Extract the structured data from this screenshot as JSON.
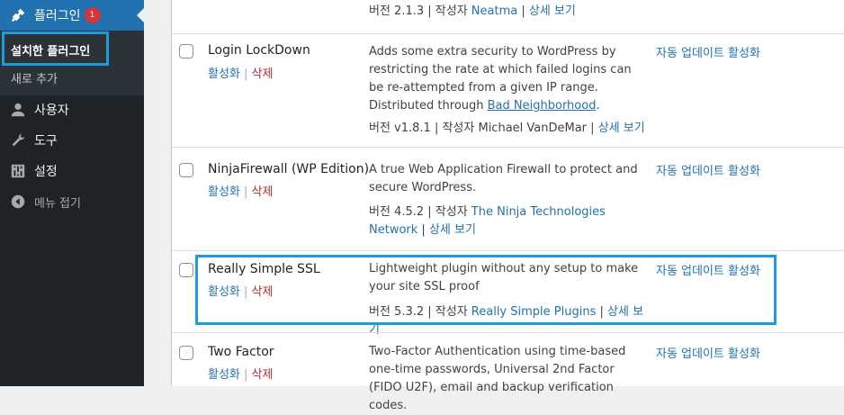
{
  "sidebar": {
    "plugins_label": "플러그인",
    "plugins_badge": "1",
    "installed_label": "설치한 플러그인",
    "add_new_label": "새로 추가",
    "users_label": "사용자",
    "tools_label": "도구",
    "settings_label": "설정",
    "collapse_label": "메뉴 접기"
  },
  "plugins": [
    {
      "name": "",
      "description": "",
      "version_line": "버전 2.1.3 | 작성자 ",
      "author": "Neatma",
      "details": "상세 보기"
    },
    {
      "name": "Login LockDown",
      "activate": "활성화",
      "delete": "삭제",
      "description": "Adds some extra security to WordPress by restricting the rate at which failed logins can be re-attempted from a given IP range. Distributed through ",
      "description_link": "Bad Neighborhood",
      "description_end": ".",
      "version_line": "버전 v1.8.1 | 작성자 Michael VanDeMar | ",
      "details": "상세 보기",
      "auto_update": "자동 업데이트 활성화"
    },
    {
      "name": "NinjaFirewall (WP Edition)",
      "activate": "활성화",
      "delete": "삭제",
      "description": "A true Web Application Firewall to protect and secure WordPress.",
      "version_line": "버전 4.5.2 | 작성자 ",
      "author": "The Ninja Technologies Network",
      "details": "상세 보기",
      "auto_update": "자동 업데이트 활성화"
    },
    {
      "name": "Really Simple SSL",
      "activate": "활성화",
      "delete": "삭제",
      "description": "Lightweight plugin without any setup to make your site SSL proof",
      "version_line": "버전 5.3.2 | 작성자 ",
      "author": "Really Simple Plugins",
      "details": "상세 보기",
      "auto_update": "자동 업데이트 활성화"
    },
    {
      "name": "Two Factor",
      "activate": "활성화",
      "delete": "삭제",
      "description": "Two-Factor Authentication using time-based one-time passwords, Universal 2nd Factor (FIDO U2F), email and backup verification codes.",
      "auto_update": "자동 업데이트 활성화"
    }
  ],
  "colors": {
    "sidebar_bg": "#1d2327",
    "accent": "#2271b1",
    "delete": "#b32d2e",
    "highlight": "#1e9bd9",
    "badge": "#d63638"
  }
}
